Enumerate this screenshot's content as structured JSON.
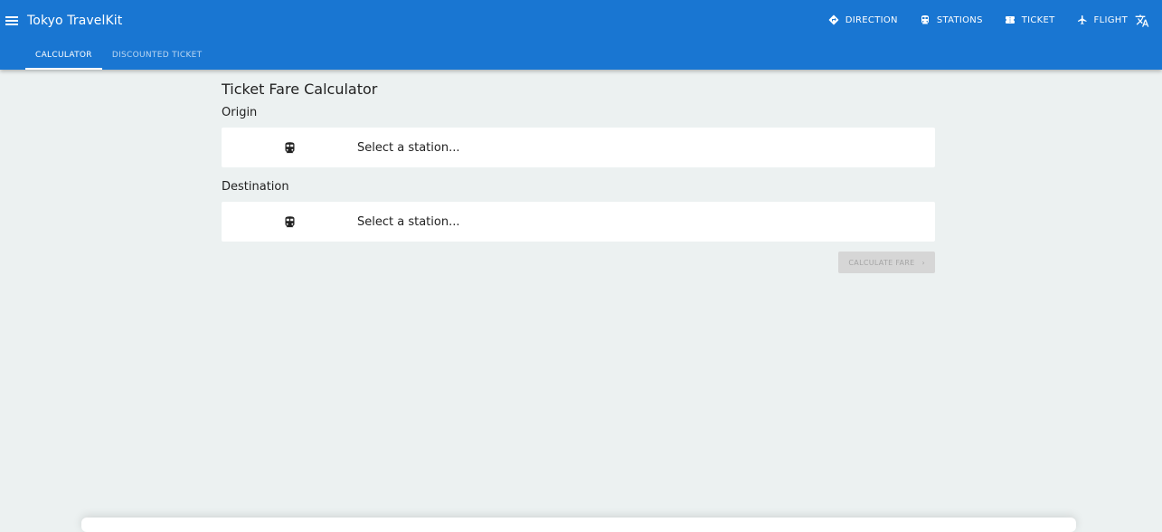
{
  "app": {
    "title": "Tokyo TravelKit"
  },
  "nav": [
    {
      "label": "DIRECTION",
      "icon": "directions-icon"
    },
    {
      "label": "STATIONS",
      "icon": "train-icon"
    },
    {
      "label": "TICKET",
      "icon": "ticket-icon"
    },
    {
      "label": "FLIGHT",
      "icon": "airplane-icon"
    }
  ],
  "tabs": [
    {
      "label": "CALCULATOR",
      "active": true
    },
    {
      "label": "DISCOUNTED TICKET",
      "active": false
    }
  ],
  "calculator": {
    "title": "Ticket Fare Calculator",
    "origin_label": "Origin",
    "origin_placeholder": "Select a station...",
    "destination_label": "Destination",
    "destination_placeholder": "Select a station...",
    "calculate_label": "CALCULATE FARE",
    "calculate_icon": "chevron-right-icon"
  },
  "colors": {
    "appbar": "#1976d2",
    "background": "#ecf1f1",
    "button_disabled": "#d6d6d6"
  }
}
